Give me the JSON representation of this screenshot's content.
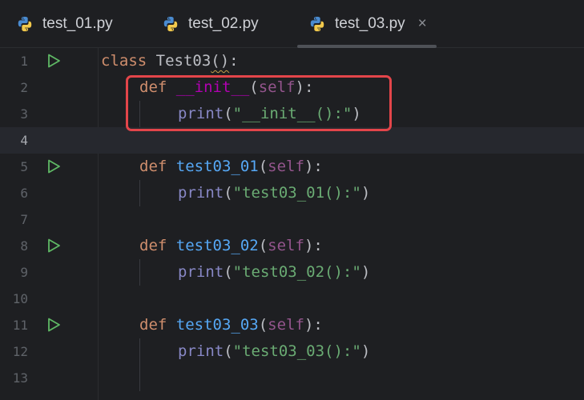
{
  "tabs": [
    {
      "label": "test_01.py",
      "icon": "python-icon",
      "active": false
    },
    {
      "label": "test_02.py",
      "icon": "python-icon",
      "active": false
    },
    {
      "label": "test_03.py",
      "icon": "python-icon",
      "active": true,
      "close": "×"
    }
  ],
  "lines": [
    {
      "num": "1",
      "run": true,
      "indent": 0,
      "tokens": [
        {
          "t": "class ",
          "c": "kw"
        },
        {
          "t": "Test03",
          "c": "cls"
        },
        {
          "t": "()",
          "c": "punc squig"
        },
        {
          "t": ":",
          "c": "punc"
        }
      ]
    },
    {
      "num": "2",
      "run": false,
      "indent": 1,
      "tokens": [
        {
          "t": "def ",
          "c": "kw"
        },
        {
          "t": "__init__",
          "c": "dunder"
        },
        {
          "t": "(",
          "c": "punc"
        },
        {
          "t": "self",
          "c": "self"
        },
        {
          "t": "):",
          "c": "punc"
        }
      ]
    },
    {
      "num": "3",
      "run": false,
      "indent": 2,
      "tokens": [
        {
          "t": "print",
          "c": "builtin"
        },
        {
          "t": "(",
          "c": "punc"
        },
        {
          "t": "\"__init__():\"",
          "c": "str"
        },
        {
          "t": ")",
          "c": "punc"
        }
      ]
    },
    {
      "num": "4",
      "run": false,
      "indent": 0,
      "current": true,
      "tokens": []
    },
    {
      "num": "5",
      "run": true,
      "indent": 1,
      "tokens": [
        {
          "t": "def ",
          "c": "kw"
        },
        {
          "t": "test03_01",
          "c": "fn"
        },
        {
          "t": "(",
          "c": "punc"
        },
        {
          "t": "self",
          "c": "self"
        },
        {
          "t": "):",
          "c": "punc"
        }
      ]
    },
    {
      "num": "6",
      "run": false,
      "indent": 2,
      "tokens": [
        {
          "t": "print",
          "c": "builtin"
        },
        {
          "t": "(",
          "c": "punc"
        },
        {
          "t": "\"test03_01():\"",
          "c": "str"
        },
        {
          "t": ")",
          "c": "punc"
        }
      ]
    },
    {
      "num": "7",
      "run": false,
      "indent": 0,
      "tokens": []
    },
    {
      "num": "8",
      "run": true,
      "indent": 1,
      "tokens": [
        {
          "t": "def ",
          "c": "kw"
        },
        {
          "t": "test03_02",
          "c": "fn"
        },
        {
          "t": "(",
          "c": "punc"
        },
        {
          "t": "self",
          "c": "self"
        },
        {
          "t": "):",
          "c": "punc"
        }
      ]
    },
    {
      "num": "9",
      "run": false,
      "indent": 2,
      "tokens": [
        {
          "t": "print",
          "c": "builtin"
        },
        {
          "t": "(",
          "c": "punc"
        },
        {
          "t": "\"test03_02():\"",
          "c": "str"
        },
        {
          "t": ")",
          "c": "punc"
        }
      ]
    },
    {
      "num": "10",
      "run": false,
      "indent": 0,
      "tokens": []
    },
    {
      "num": "11",
      "run": true,
      "indent": 1,
      "tokens": [
        {
          "t": "def ",
          "c": "kw"
        },
        {
          "t": "test03_03",
          "c": "fn"
        },
        {
          "t": "(",
          "c": "punc"
        },
        {
          "t": "self",
          "c": "self"
        },
        {
          "t": "):",
          "c": "punc"
        }
      ]
    },
    {
      "num": "12",
      "run": false,
      "indent": 2,
      "tokens": [
        {
          "t": "print",
          "c": "builtin"
        },
        {
          "t": "(",
          "c": "punc"
        },
        {
          "t": "\"test03_03():\"",
          "c": "str"
        },
        {
          "t": ")",
          "c": "punc"
        }
      ]
    },
    {
      "num": "13",
      "run": false,
      "indent": 0,
      "tokens": []
    }
  ],
  "colors": {
    "background": "#1e1f22",
    "current_line": "#26282e",
    "highlight_box": "#e3454a",
    "run_icon": "#5fb865"
  }
}
